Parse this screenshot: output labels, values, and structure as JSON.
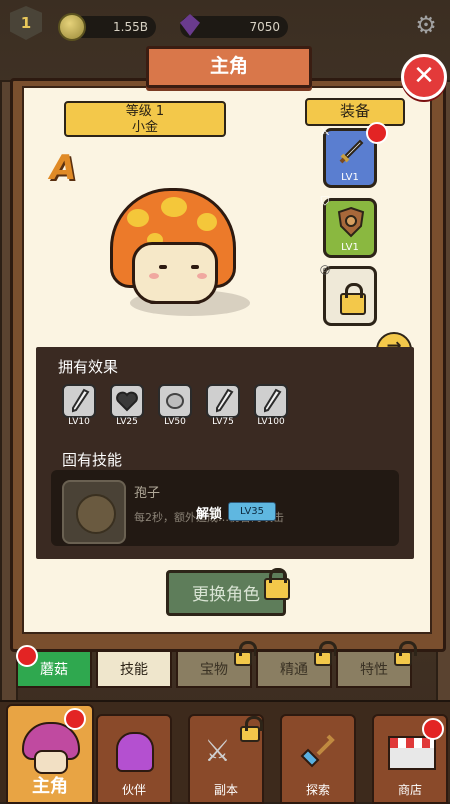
{
  "topbar": {
    "level": "1",
    "coins": "1.55B",
    "gems": "7050"
  },
  "title": "主角",
  "level_ribbon": {
    "level": "等级 1",
    "name": "小金"
  },
  "grade": "A",
  "equipment": {
    "title": "装备",
    "slots": [
      {
        "kind": "weapon",
        "level": "LV1",
        "locked": false,
        "has_alert": true
      },
      {
        "kind": "shield",
        "level": "LV1",
        "locked": false,
        "has_alert": false
      },
      {
        "kind": "accessory",
        "level": "",
        "locked": true,
        "has_alert": false
      }
    ]
  },
  "effects": {
    "title": "拥有效果",
    "items": [
      {
        "icon": "sword-icon",
        "level": "LV10"
      },
      {
        "icon": "heart-icon",
        "level": "LV25"
      },
      {
        "icon": "orb-icon",
        "level": "LV50"
      },
      {
        "icon": "sword-icon",
        "level": "LV75"
      },
      {
        "icon": "sword-icon",
        "level": "LV100"
      }
    ]
  },
  "skills": {
    "title": "固有技能",
    "name": "孢子",
    "description": "每2秒，额外造成…伤害的攻击",
    "unlock_label": "解锁",
    "unlock_level": "LV35"
  },
  "change_button": "更换角色",
  "subtabs": [
    {
      "label": "蘑菇",
      "active": true,
      "locked": false,
      "alert": true
    },
    {
      "label": "技能",
      "active": false,
      "locked": false,
      "alert": false
    },
    {
      "label": "宝物",
      "active": false,
      "locked": true,
      "alert": false
    },
    {
      "label": "精通",
      "active": false,
      "locked": true,
      "alert": false
    },
    {
      "label": "特性",
      "active": false,
      "locked": true,
      "alert": false
    }
  ],
  "bottom_nav": [
    {
      "label": "主角",
      "active": true,
      "alert": true
    },
    {
      "label": "伙伴",
      "active": false,
      "alert": false
    },
    {
      "label": "副本",
      "active": false,
      "alert": false,
      "locked": true
    },
    {
      "label": "探索",
      "active": false,
      "alert": false
    },
    {
      "label": "商店",
      "active": false,
      "alert": true
    }
  ],
  "colors": {
    "accent": "#f3c84a",
    "alert": "#e32424",
    "active_tab": "#2fa84f",
    "mushroom_cap": "#ec7a2a"
  }
}
